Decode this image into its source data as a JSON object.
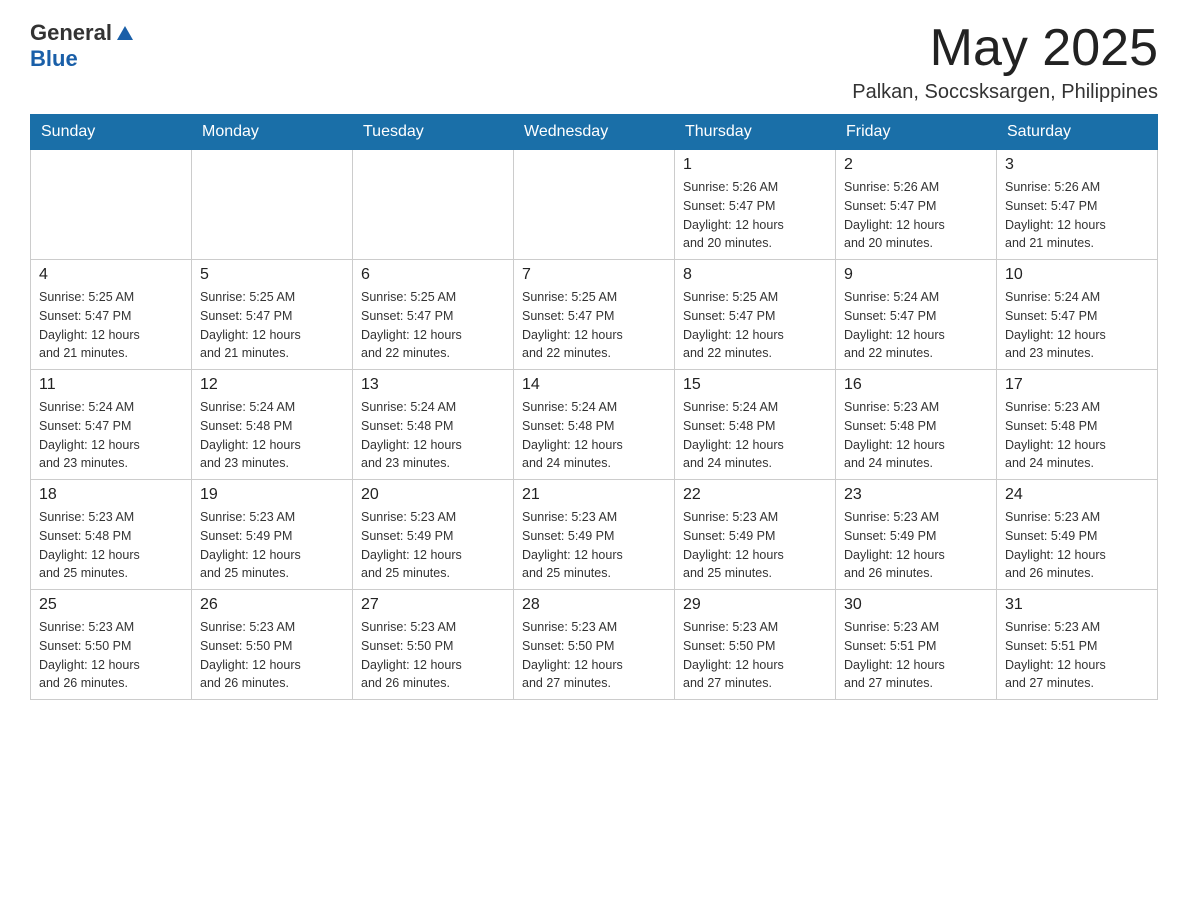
{
  "header": {
    "logo": {
      "general": "General",
      "blue": "Blue"
    },
    "month": "May 2025",
    "location": "Palkan, Soccsksargen, Philippines"
  },
  "weekdays": [
    "Sunday",
    "Monday",
    "Tuesday",
    "Wednesday",
    "Thursday",
    "Friday",
    "Saturday"
  ],
  "weeks": [
    [
      {
        "day": "",
        "info": ""
      },
      {
        "day": "",
        "info": ""
      },
      {
        "day": "",
        "info": ""
      },
      {
        "day": "",
        "info": ""
      },
      {
        "day": "1",
        "sunrise": "5:26 AM",
        "sunset": "5:47 PM",
        "daylight": "12 hours and 20 minutes."
      },
      {
        "day": "2",
        "sunrise": "5:26 AM",
        "sunset": "5:47 PM",
        "daylight": "12 hours and 20 minutes."
      },
      {
        "day": "3",
        "sunrise": "5:26 AM",
        "sunset": "5:47 PM",
        "daylight": "12 hours and 21 minutes."
      }
    ],
    [
      {
        "day": "4",
        "sunrise": "5:25 AM",
        "sunset": "5:47 PM",
        "daylight": "12 hours and 21 minutes."
      },
      {
        "day": "5",
        "sunrise": "5:25 AM",
        "sunset": "5:47 PM",
        "daylight": "12 hours and 21 minutes."
      },
      {
        "day": "6",
        "sunrise": "5:25 AM",
        "sunset": "5:47 PM",
        "daylight": "12 hours and 22 minutes."
      },
      {
        "day": "7",
        "sunrise": "5:25 AM",
        "sunset": "5:47 PM",
        "daylight": "12 hours and 22 minutes."
      },
      {
        "day": "8",
        "sunrise": "5:25 AM",
        "sunset": "5:47 PM",
        "daylight": "12 hours and 22 minutes."
      },
      {
        "day": "9",
        "sunrise": "5:24 AM",
        "sunset": "5:47 PM",
        "daylight": "12 hours and 22 minutes."
      },
      {
        "day": "10",
        "sunrise": "5:24 AM",
        "sunset": "5:47 PM",
        "daylight": "12 hours and 23 minutes."
      }
    ],
    [
      {
        "day": "11",
        "sunrise": "5:24 AM",
        "sunset": "5:47 PM",
        "daylight": "12 hours and 23 minutes."
      },
      {
        "day": "12",
        "sunrise": "5:24 AM",
        "sunset": "5:48 PM",
        "daylight": "12 hours and 23 minutes."
      },
      {
        "day": "13",
        "sunrise": "5:24 AM",
        "sunset": "5:48 PM",
        "daylight": "12 hours and 23 minutes."
      },
      {
        "day": "14",
        "sunrise": "5:24 AM",
        "sunset": "5:48 PM",
        "daylight": "12 hours and 24 minutes."
      },
      {
        "day": "15",
        "sunrise": "5:24 AM",
        "sunset": "5:48 PM",
        "daylight": "12 hours and 24 minutes."
      },
      {
        "day": "16",
        "sunrise": "5:23 AM",
        "sunset": "5:48 PM",
        "daylight": "12 hours and 24 minutes."
      },
      {
        "day": "17",
        "sunrise": "5:23 AM",
        "sunset": "5:48 PM",
        "daylight": "12 hours and 24 minutes."
      }
    ],
    [
      {
        "day": "18",
        "sunrise": "5:23 AM",
        "sunset": "5:48 PM",
        "daylight": "12 hours and 25 minutes."
      },
      {
        "day": "19",
        "sunrise": "5:23 AM",
        "sunset": "5:49 PM",
        "daylight": "12 hours and 25 minutes."
      },
      {
        "day": "20",
        "sunrise": "5:23 AM",
        "sunset": "5:49 PM",
        "daylight": "12 hours and 25 minutes."
      },
      {
        "day": "21",
        "sunrise": "5:23 AM",
        "sunset": "5:49 PM",
        "daylight": "12 hours and 25 minutes."
      },
      {
        "day": "22",
        "sunrise": "5:23 AM",
        "sunset": "5:49 PM",
        "daylight": "12 hours and 25 minutes."
      },
      {
        "day": "23",
        "sunrise": "5:23 AM",
        "sunset": "5:49 PM",
        "daylight": "12 hours and 26 minutes."
      },
      {
        "day": "24",
        "sunrise": "5:23 AM",
        "sunset": "5:49 PM",
        "daylight": "12 hours and 26 minutes."
      }
    ],
    [
      {
        "day": "25",
        "sunrise": "5:23 AM",
        "sunset": "5:50 PM",
        "daylight": "12 hours and 26 minutes."
      },
      {
        "day": "26",
        "sunrise": "5:23 AM",
        "sunset": "5:50 PM",
        "daylight": "12 hours and 26 minutes."
      },
      {
        "day": "27",
        "sunrise": "5:23 AM",
        "sunset": "5:50 PM",
        "daylight": "12 hours and 26 minutes."
      },
      {
        "day": "28",
        "sunrise": "5:23 AM",
        "sunset": "5:50 PM",
        "daylight": "12 hours and 27 minutes."
      },
      {
        "day": "29",
        "sunrise": "5:23 AM",
        "sunset": "5:50 PM",
        "daylight": "12 hours and 27 minutes."
      },
      {
        "day": "30",
        "sunrise": "5:23 AM",
        "sunset": "5:51 PM",
        "daylight": "12 hours and 27 minutes."
      },
      {
        "day": "31",
        "sunrise": "5:23 AM",
        "sunset": "5:51 PM",
        "daylight": "12 hours and 27 minutes."
      }
    ]
  ],
  "labels": {
    "sunrise": "Sunrise:",
    "sunset": "Sunset:",
    "daylight": "Daylight:"
  }
}
